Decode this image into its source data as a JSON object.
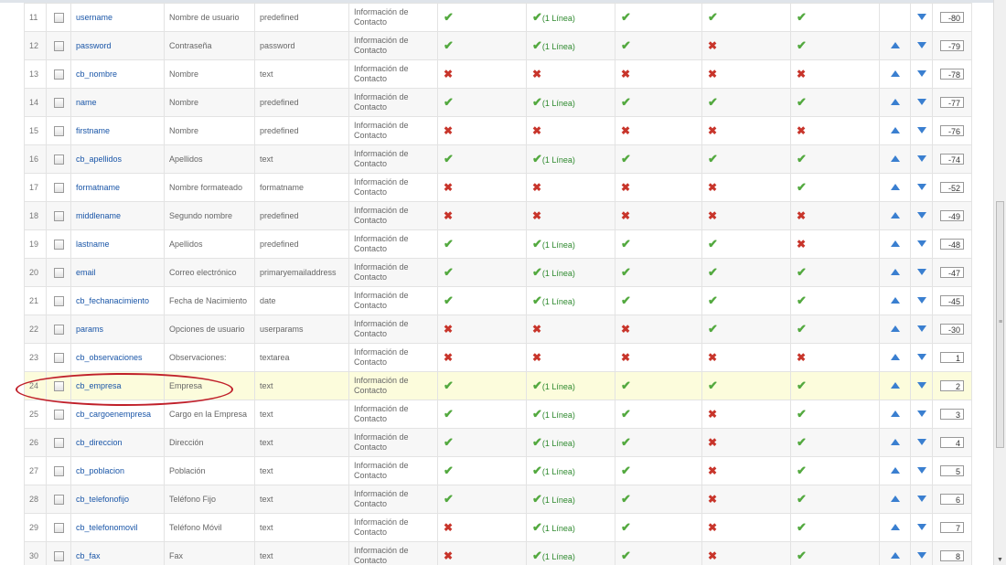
{
  "line_label": "(1 Línea)",
  "rows": [
    {
      "num": "11",
      "name": "username",
      "title": "Nombre de usuario",
      "type": "predefined",
      "group": "Información de Contacto",
      "c1": true,
      "c2": true,
      "c2line": true,
      "c3": true,
      "c4": true,
      "c5": true,
      "up": false,
      "down": true,
      "order": "-80"
    },
    {
      "num": "12",
      "name": "password",
      "title": "Contraseña",
      "type": "password",
      "group": "Información de Contacto",
      "c1": true,
      "c2": true,
      "c2line": true,
      "c3": true,
      "c4": false,
      "c5": true,
      "up": true,
      "down": true,
      "order": "-79"
    },
    {
      "num": "13",
      "name": "cb_nombre",
      "title": "Nombre",
      "type": "text",
      "group": "Información de Contacto",
      "c1": false,
      "c2": false,
      "c2line": false,
      "c3": false,
      "c4": false,
      "c5": false,
      "up": true,
      "down": true,
      "order": "-78"
    },
    {
      "num": "14",
      "name": "name",
      "title": "Nombre",
      "type": "predefined",
      "group": "Información de Contacto",
      "c1": true,
      "c2": true,
      "c2line": true,
      "c3": true,
      "c4": true,
      "c5": true,
      "up": true,
      "down": true,
      "order": "-77"
    },
    {
      "num": "15",
      "name": "firstname",
      "title": "Nombre",
      "type": "predefined",
      "group": "Información de Contacto",
      "c1": false,
      "c2": false,
      "c2line": false,
      "c3": false,
      "c4": false,
      "c5": false,
      "up": true,
      "down": true,
      "order": "-76"
    },
    {
      "num": "16",
      "name": "cb_apellidos",
      "title": "Apellidos",
      "type": "text",
      "group": "Información de Contacto",
      "c1": true,
      "c2": true,
      "c2line": true,
      "c3": true,
      "c4": true,
      "c5": true,
      "up": true,
      "down": true,
      "order": "-74"
    },
    {
      "num": "17",
      "name": "formatname",
      "title": "Nombre formateado",
      "type": "formatname",
      "group": "Información de Contacto",
      "c1": false,
      "c2": false,
      "c2line": false,
      "c3": false,
      "c4": false,
      "c5": true,
      "up": true,
      "down": true,
      "order": "-52"
    },
    {
      "num": "18",
      "name": "middlename",
      "title": "Segundo nombre",
      "type": "predefined",
      "group": "Información de Contacto",
      "c1": false,
      "c2": false,
      "c2line": false,
      "c3": false,
      "c4": false,
      "c5": false,
      "up": true,
      "down": true,
      "order": "-49"
    },
    {
      "num": "19",
      "name": "lastname",
      "title": "Apellidos",
      "type": "predefined",
      "group": "Información de Contacto",
      "c1": true,
      "c2": true,
      "c2line": true,
      "c3": true,
      "c4": true,
      "c5": false,
      "up": true,
      "down": true,
      "order": "-48"
    },
    {
      "num": "20",
      "name": "email",
      "title": "Correo electrónico",
      "type": "primaryemailaddress",
      "group": "Información de Contacto",
      "c1": true,
      "c2": true,
      "c2line": true,
      "c3": true,
      "c4": true,
      "c5": true,
      "up": true,
      "down": true,
      "order": "-47"
    },
    {
      "num": "21",
      "name": "cb_fechanacimiento",
      "title": "Fecha de Nacimiento",
      "type": "date",
      "group": "Información de Contacto",
      "c1": true,
      "c2": true,
      "c2line": true,
      "c3": true,
      "c4": true,
      "c5": true,
      "up": true,
      "down": true,
      "order": "-45"
    },
    {
      "num": "22",
      "name": "params",
      "title": "Opciones de usuario",
      "type": "userparams",
      "group": "Información de Contacto",
      "c1": false,
      "c2": false,
      "c2line": false,
      "c3": false,
      "c4": true,
      "c5": true,
      "up": true,
      "down": true,
      "order": "-30"
    },
    {
      "num": "23",
      "name": "cb_observaciones",
      "title": "Observaciones:",
      "type": "textarea",
      "group": "Información de Contacto",
      "c1": false,
      "c2": false,
      "c2line": false,
      "c3": false,
      "c4": false,
      "c5": false,
      "up": true,
      "down": true,
      "order": "1"
    },
    {
      "num": "24",
      "name": "cb_empresa",
      "title": "Empresa",
      "type": "text",
      "group": "Información de Contacto",
      "c1": true,
      "c2": true,
      "c2line": true,
      "c3": true,
      "c4": true,
      "c5": true,
      "up": true,
      "down": true,
      "order": "2"
    },
    {
      "num": "25",
      "name": "cb_cargoenempresa",
      "title": "Cargo en la Empresa",
      "type": "text",
      "group": "Información de Contacto",
      "c1": true,
      "c2": true,
      "c2line": true,
      "c3": true,
      "c4": false,
      "c5": true,
      "up": true,
      "down": true,
      "order": "3"
    },
    {
      "num": "26",
      "name": "cb_direccion",
      "title": "Dirección",
      "type": "text",
      "group": "Información de Contacto",
      "c1": true,
      "c2": true,
      "c2line": true,
      "c3": true,
      "c4": false,
      "c5": true,
      "up": true,
      "down": true,
      "order": "4"
    },
    {
      "num": "27",
      "name": "cb_poblacion",
      "title": "Población",
      "type": "text",
      "group": "Información de Contacto",
      "c1": true,
      "c2": true,
      "c2line": true,
      "c3": true,
      "c4": false,
      "c5": true,
      "up": true,
      "down": true,
      "order": "5"
    },
    {
      "num": "28",
      "name": "cb_telefonofijo",
      "title": "Teléfono Fijo",
      "type": "text",
      "group": "Información de Contacto",
      "c1": true,
      "c2": true,
      "c2line": true,
      "c3": true,
      "c4": false,
      "c5": true,
      "up": true,
      "down": true,
      "order": "6"
    },
    {
      "num": "29",
      "name": "cb_telefonomovil",
      "title": "Teléfono Móvil",
      "type": "text",
      "group": "Información de Contacto",
      "c1": false,
      "c2": true,
      "c2line": true,
      "c3": true,
      "c4": false,
      "c5": true,
      "up": true,
      "down": true,
      "order": "7"
    },
    {
      "num": "30",
      "name": "cb_fax",
      "title": "Fax",
      "type": "text",
      "group": "Información de Contacto",
      "c1": false,
      "c2": true,
      "c2line": true,
      "c3": true,
      "c4": false,
      "c5": true,
      "up": true,
      "down": true,
      "order": "8"
    }
  ],
  "highlighted_row": "24",
  "colors": {
    "accent_link": "#1a56a8",
    "yes": "#53a93f",
    "no": "#c8352b",
    "arrows": "#3a7fd0",
    "highlight": "#fcfcdc",
    "annotation": "#c0202a"
  },
  "icons": {
    "yes": "check-icon",
    "no": "cross-icon",
    "up": "arrow-up-icon",
    "down": "arrow-down-icon"
  }
}
